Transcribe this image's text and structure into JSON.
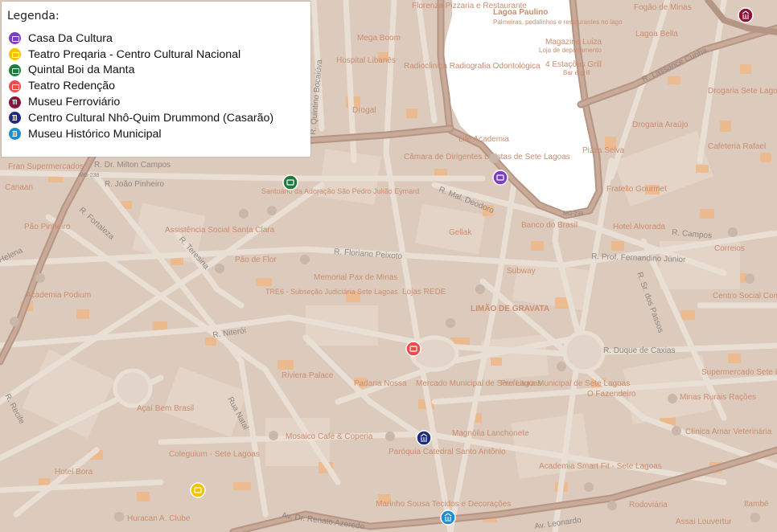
{
  "legend": {
    "title": "Legenda:",
    "items": [
      {
        "label": "Casa Da Cultura",
        "color": "#7b3fc4",
        "icon": "theater-icon"
      },
      {
        "label": "Teatro Preqaria - Centro Cultural Nacional",
        "color": "#f2c400",
        "icon": "theater-icon"
      },
      {
        "label": "Quintal Boi da Manta",
        "color": "#1f7a3c",
        "icon": "theater-icon"
      },
      {
        "label": "Teatro Redenção",
        "color": "#ee4b4b",
        "icon": "theater-icon"
      },
      {
        "label": "Museu Ferroviário",
        "color": "#8a1238",
        "icon": "museum-icon"
      },
      {
        "label": "Centro Cultural Nhô-Quim Drummond (Casarão)",
        "color": "#1d2a80",
        "icon": "museum-icon"
      },
      {
        "label": "Museu Histórico Municipal",
        "color": "#1a8fd6",
        "icon": "museum-icon"
      }
    ]
  },
  "streets": [
    "R. João Pinheiro",
    "R. Fortaleza",
    "R. Teresina",
    "R. Niterói",
    "Rua Natal",
    "R. Recife",
    "R. Floriano Peixoto",
    "R. Mal. Deodoro",
    "R. Prof. Fernandino Júnior",
    "R. Campos",
    "R. Duque de Caxias",
    "R. Sr. dos Passos",
    "R. Lassance Cunha",
    "Av. Dr. Renato Azeredo",
    "R. Quintino Bocaiúva",
    "R. Dr. Milton Campos",
    "MG-238",
    "Helena",
    "Av. Leonardo"
  ],
  "pois": [
    "Florenza Pizzaria e Restaurante",
    "Lagoa Paulino",
    "Palmeiras, pedalinhos e restaurantes no lago",
    "Magazine Luiza",
    "Loja de departamento",
    "4 Estações Grill",
    "Bar e grill",
    "Mega Boom",
    "Hospital Libanês",
    "Radioclinica Radiografia Odontológica",
    "Drogal",
    "Life Academia",
    "Câmara de Dirigentes Lojistas de Sete Lagoas",
    "Santuário da Adoração São Pedro Julião Eymard",
    "Assistência Social Santa Clara",
    "Pão de Flor",
    "Memorial Pax de Minas",
    "TRE6 - Subseção Judiciária Sete Lagoas",
    "Lojas REDE",
    "LIMÃO DE GRAVATA",
    "Gellak",
    "Subway",
    "Banco do Brasil",
    "Hotel Alvorada",
    "Drogaria Araújo",
    "Correios",
    "Padaria Nossa",
    "Mercado Municipal de Sete Lagoas",
    "Prefeitura Municipal de Sete Lagoas",
    "Riviera Palace",
    "Mosaico Café & Coperia",
    "Paróquia Catedral Santo Antônio",
    "Magnólia Lanchonete",
    "Academia Smart Fit - Sete Lagoas",
    "Rodoviária",
    "Clínica Amar Veterinária",
    "Minas Rurais Rações",
    "Centro Social Comunitário",
    "Supermercado Sete Lagoas",
    "Açaí Bem Brasil",
    "Coleguium - Sete Lagoas",
    "Academia Podium",
    "Huracan A. Clube",
    "Marinho Sousa Tecidos e Decorações",
    "Fogão de Minas",
    "Lagoa Bella",
    "Drogaria Sete Lagoas",
    "Pizza Seiva",
    "Fratello Gourmet",
    "Fran Supermercados",
    "Canaan",
    "Pão Pinheiro",
    "Hotel Bora",
    "Cafeteria Rafael",
    "Itambé",
    "Assai Louvertur",
    "O Fazendeiro"
  ]
}
